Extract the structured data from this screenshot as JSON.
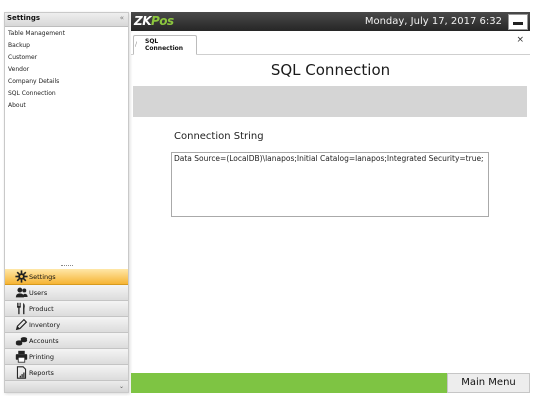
{
  "sidebar": {
    "title": "Settings",
    "items": [
      {
        "label": "Table Management"
      },
      {
        "label": "Backup"
      },
      {
        "label": "Customer"
      },
      {
        "label": "Vendor"
      },
      {
        "label": "Company Details"
      },
      {
        "label": "SQL Connection"
      },
      {
        "label": "About"
      }
    ],
    "nav": [
      {
        "label": "Settings",
        "icon": "gear-icon",
        "active": true
      },
      {
        "label": "Users",
        "icon": "users-icon",
        "active": false
      },
      {
        "label": "Product",
        "icon": "fork-knife-icon",
        "active": false
      },
      {
        "label": "Inventory",
        "icon": "pencil-icon",
        "active": false
      },
      {
        "label": "Accounts",
        "icon": "coins-icon",
        "active": false
      },
      {
        "label": "Printing",
        "icon": "printer-icon",
        "active": false
      },
      {
        "label": "Reports",
        "icon": "report-icon",
        "active": false
      }
    ]
  },
  "header": {
    "logo_zk": "ZK",
    "logo_pos": "Pos",
    "datetime": "Monday, July 17, 2017 6:32"
  },
  "tab": {
    "label_line1": "SQL",
    "label_line2": "Connection",
    "close": "×"
  },
  "main": {
    "title": "SQL Connection",
    "connection_label": "Connection String",
    "connection_value": "Data Source=(LocalDB)\\lanapos;Initial Catalog=lanapos;Integrated Security=true;"
  },
  "footer": {
    "main_menu_label": "Main Menu"
  },
  "colors": {
    "accent_green": "#7ec443",
    "active_nav": "#f6b434",
    "topbar": "#262626"
  }
}
